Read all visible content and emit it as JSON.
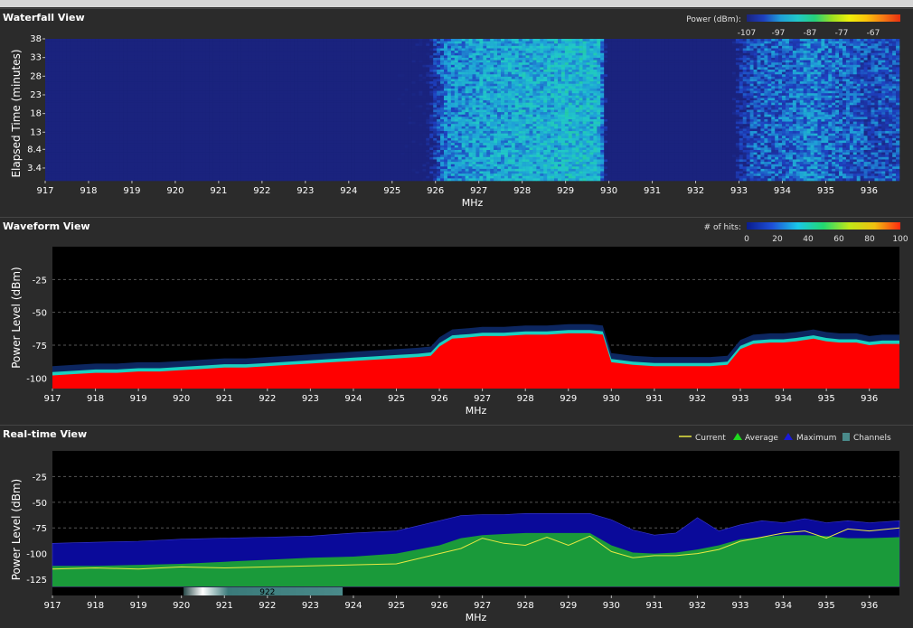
{
  "waterfall": {
    "title": "Waterfall View",
    "legend_title": "Power (dBm):",
    "legend_ticks": [
      "-107",
      "-97",
      "-87",
      "-77",
      "-67"
    ],
    "colors": [
      "#1a237e",
      "#1e40c0",
      "#1fa0d8",
      "#21c8c8",
      "#26d07a",
      "#9be022",
      "#eef00a",
      "#fbc40a",
      "#f67914",
      "#e83010"
    ]
  },
  "waveform": {
    "title": "Waveform View",
    "legend_title": "# of hits:",
    "legend_ticks": [
      "0",
      "20",
      "40",
      "60",
      "80",
      "100"
    ],
    "colors": [
      "#0a1c8c",
      "#1e50d8",
      "#1ac8e8",
      "#22d870",
      "#c0e818",
      "#f0c010",
      "#ff2a10"
    ]
  },
  "realtime": {
    "title": "Real-time View",
    "legend": {
      "current": "Current",
      "average": "Average",
      "maximum": "Maximum",
      "channels": "Channels"
    },
    "channel_label": "922",
    "colors": {
      "current": "#e8e842",
      "average": "#1a9a3a",
      "maximum": "#0a0a9a",
      "channels": "#4a8a8a"
    }
  },
  "chart_data": [
    {
      "type": "heatmap",
      "title": "Waterfall View",
      "xlabel": "MHz",
      "ylabel": "Elapsed Time (minutes)",
      "x_ticks": [
        "917",
        "918",
        "919",
        "920",
        "921",
        "922",
        "923",
        "924",
        "925",
        "926",
        "927",
        "928",
        "929",
        "930",
        "931",
        "932",
        "933",
        "934",
        "935",
        "936"
      ],
      "y_ticks": [
        "38",
        "33",
        "28",
        "23",
        "18",
        "13",
        "8.4",
        "3.4"
      ],
      "xlim": [
        917,
        936.7
      ],
      "ylim": [
        0,
        38
      ],
      "colorbar_title": "Power (dBm):",
      "colorbar_ticks": [
        -107,
        -97,
        -87,
        -77,
        -67
      ]
    },
    {
      "type": "area",
      "title": "Waveform View",
      "xlabel": "MHz",
      "ylabel": "Power Level (dBm)",
      "y_ticks": [
        "-25",
        "-50",
        "-75",
        "-100"
      ],
      "xlim": [
        917,
        936.7
      ],
      "ylim": [
        -108,
        0
      ],
      "x": [
        917,
        917.5,
        918,
        918.5,
        919,
        919.5,
        920,
        920.5,
        921,
        921.5,
        922,
        922.5,
        923,
        923.5,
        924,
        924.5,
        925,
        925.5,
        925.8,
        926,
        926.3,
        926.7,
        927,
        927.5,
        928,
        928.5,
        929,
        929.5,
        929.8,
        930,
        930.5,
        931,
        931.5,
        932,
        932.3,
        932.7,
        933,
        933.3,
        933.7,
        934,
        934.3,
        934.7,
        935,
        935.3,
        935.7,
        936,
        936.3,
        936.7
      ],
      "series": [
        {
          "values": [
            -98,
            -97,
            -96,
            -96,
            -95,
            -95,
            -94,
            -93,
            -92,
            -92,
            -91,
            -90,
            -89,
            -88,
            -87,
            -86,
            -85,
            -84,
            -83,
            -76,
            -70,
            -69,
            -68,
            -68,
            -67,
            -67,
            -66,
            -66,
            -67,
            -88,
            -90,
            -91,
            -91,
            -91,
            -91,
            -90,
            -78,
            -74,
            -73,
            -73,
            -72,
            -70,
            -72,
            -73,
            -73,
            -75,
            -74,
            -74
          ]
        }
      ]
    },
    {
      "type": "area",
      "title": "Real-time View",
      "xlabel": "MHz",
      "ylabel": "Power Level (dBm)",
      "y_ticks": [
        "-25",
        "-50",
        "-75",
        "-100",
        "-125"
      ],
      "xlim": [
        917,
        936.7
      ],
      "ylim": [
        -132,
        0
      ],
      "x": [
        917,
        918,
        919,
        920,
        921,
        922,
        923,
        924,
        925,
        926,
        926.5,
        927,
        927.5,
        928,
        928.5,
        929,
        929.5,
        930,
        930.5,
        931,
        931.5,
        932,
        932.5,
        933,
        933.5,
        934,
        934.5,
        935,
        935.5,
        936,
        936.7
      ],
      "series": [
        {
          "name": "Maximum",
          "values": [
            -90,
            -89,
            -88,
            -86,
            -85,
            -84,
            -83,
            -80,
            -78,
            -68,
            -63,
            -62,
            -62,
            -61,
            -61,
            -61,
            -61,
            -67,
            -77,
            -82,
            -80,
            -65,
            -78,
            -72,
            -68,
            -70,
            -66,
            -70,
            -68,
            -70,
            -68
          ]
        },
        {
          "name": "Average",
          "values": [
            -112,
            -112,
            -111,
            -110,
            -108,
            -106,
            -104,
            -103,
            -100,
            -92,
            -85,
            -82,
            -81,
            -80,
            -80,
            -80,
            -80,
            -92,
            -99,
            -100,
            -99,
            -96,
            -92,
            -86,
            -84,
            -82,
            -82,
            -83,
            -85,
            -85,
            -84
          ]
        },
        {
          "name": "Current",
          "values": [
            -115,
            -114,
            -115,
            -113,
            -114,
            -113,
            -112,
            -111,
            -110,
            -100,
            -95,
            -85,
            -90,
            -92,
            -84,
            -92,
            -83,
            -98,
            -104,
            -102,
            -102,
            -100,
            -96,
            -88,
            -84,
            -80,
            -78,
            -85,
            -76,
            -78,
            -75
          ]
        }
      ]
    }
  ]
}
